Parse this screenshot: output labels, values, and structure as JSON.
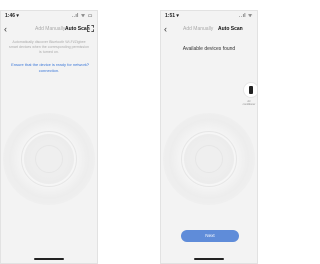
{
  "left_screen": {
    "status": {
      "time": "1:46 ▾",
      "icons": "..ıl ᯤ ▭"
    },
    "nav": {
      "back_icon": "back-icon",
      "tab_manual": "Add Manually",
      "tab_auto": "Auto Scan",
      "scan_icon": "scan-icon"
    },
    "description": "Automatically discover Bluetooth Wi-Fi/Zigbee smart devices when the corresponding permission is turned on.",
    "ensure_link": "Ensure that the device is ready for network connection.",
    "ensure_chevron": "›"
  },
  "right_screen": {
    "status": {
      "time": "1:51 ▾",
      "icons": "..ıl ᯤ"
    },
    "nav": {
      "back_icon": "back-icon",
      "tab_manual": "Add Manually",
      "tab_auto": "Auto Scan"
    },
    "found_title": "Available devices found",
    "device": {
      "icon": "device-icon",
      "label": "Air conditioner"
    },
    "next_label": "Next"
  },
  "colors": {
    "accent": "#5f8cd9",
    "link": "#3a77d8",
    "background": "#f3f3f3"
  }
}
